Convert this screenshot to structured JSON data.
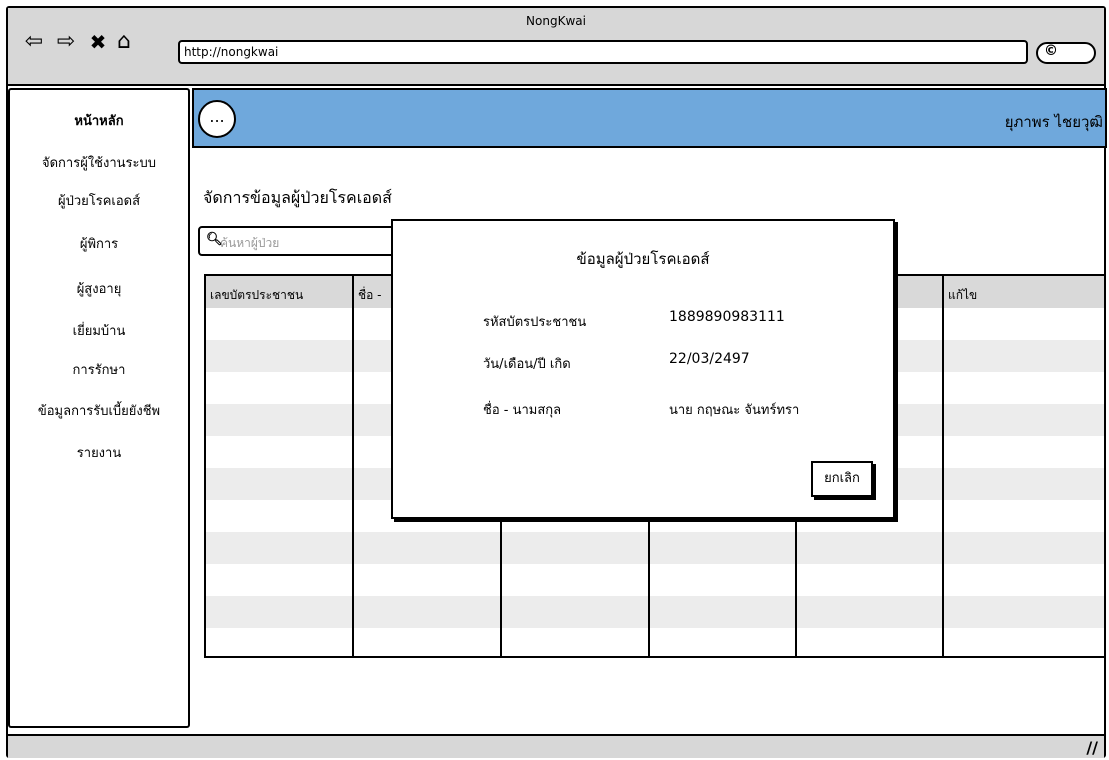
{
  "window": {
    "title": "NongKwai"
  },
  "browser": {
    "url": "http://nongkwai",
    "back_icon": "⇦",
    "forward_icon": "⇨",
    "close_icon": "✖",
    "home_icon": "⌂",
    "search_icon": "©"
  },
  "sidebar": {
    "items": [
      {
        "label": "หน้าหลัก"
      },
      {
        "label": "จัดการผู้ใช้งานระบบ"
      },
      {
        "label": "ผู้ป่วยโรคเอดส์"
      },
      {
        "label": "ผู้พิการ"
      },
      {
        "label": "ผู้สูงอายุ"
      },
      {
        "label": "เยี่ยมบ้าน"
      },
      {
        "label": "การรักษา"
      },
      {
        "label": "ข้อมูลการรับเบี้ยยังชีพ"
      },
      {
        "label": "รายงาน"
      }
    ]
  },
  "header": {
    "menu_label": "...",
    "user_name": "ยุภาพร  ไชยวุฒิ",
    "color": "#6fa8dc"
  },
  "main": {
    "title": "จัดการข้อมูลผู้ป่วยโรคเอดส์",
    "search_placeholder": "ค้นหาผู้ป่วย",
    "table": {
      "columns": [
        "เลขบัตรประชาชน",
        "ชื่อ  -",
        "",
        "",
        "",
        "แก้ไข"
      ]
    }
  },
  "modal": {
    "title": "ข้อมูลผู้ป่วยโรคเอดส์",
    "fields": [
      {
        "label": "รหัสบัตรประชาชน",
        "value": "1889890983111"
      },
      {
        "label": "วัน/เดือน/ปี เกิด",
        "value": "22/03/2497"
      },
      {
        "label": "ชื่อ  -  นามสกุล",
        "value": "นาย  กฤษณะ  จันทร์ทรา"
      }
    ],
    "cancel_label": "ยกเลิก"
  },
  "footer": {
    "resize_icon": "//"
  }
}
